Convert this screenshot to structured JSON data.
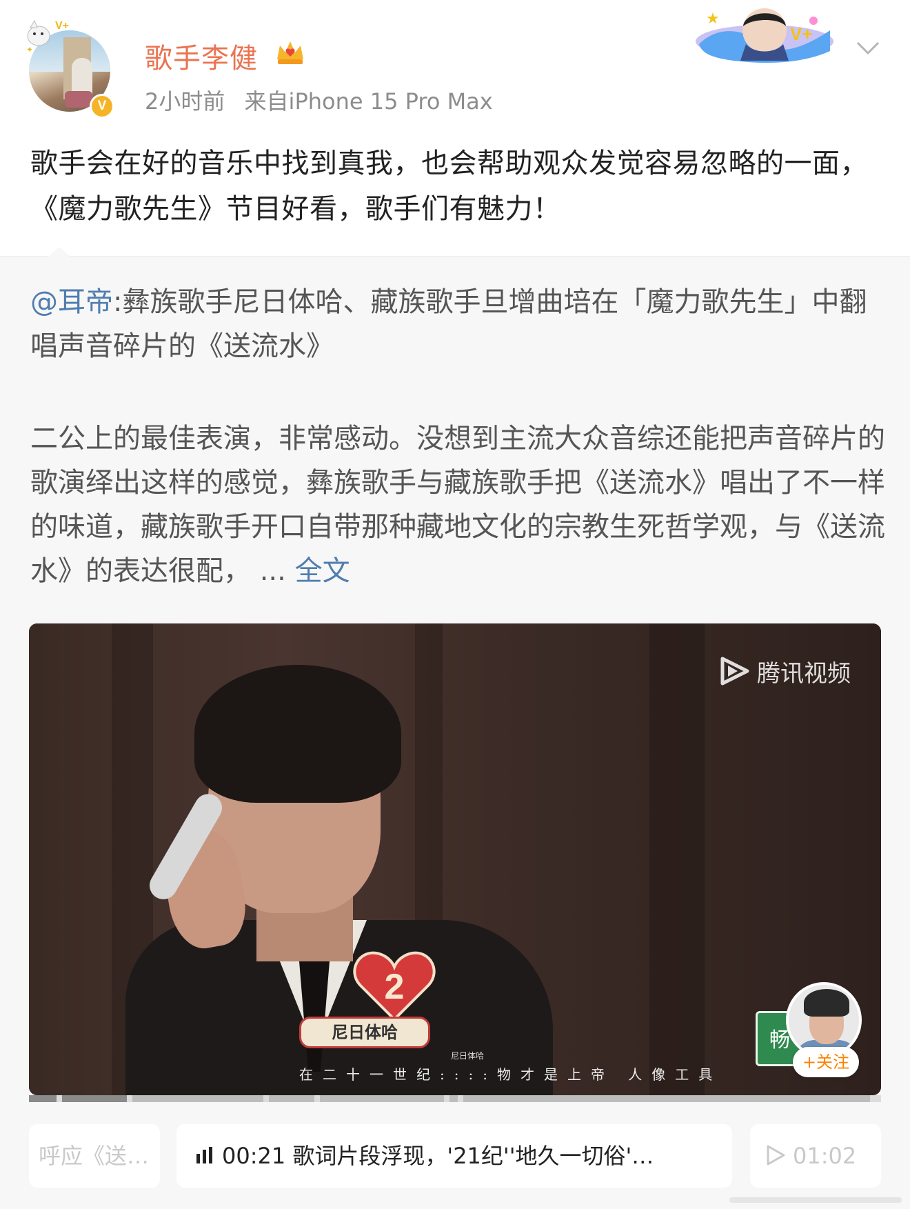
{
  "author": {
    "name": "歌手李健",
    "time": "2小时前",
    "source": "来自iPhone 15 Pro Max",
    "verified_mark": "V"
  },
  "post": {
    "text": "歌手会在好的音乐中找到真我，也会帮助观众发觉容易忽略的一面，《魔力歌先生》节目好看，歌手们有魅力！"
  },
  "repost": {
    "mention": "@耳帝",
    "header_text": ":彝族歌手尼日体哈、藏族歌手旦增曲培在「魔力歌先生」中翻唱声音碎片的《送流水》",
    "body_text": "二公上的最佳表演，非常感动。没想到主流大众音综还能把声音碎片的歌演绎出这样的感觉，彝族歌手与藏族歌手把《送流水》唱出了不一样的味道，藏族歌手开口自带那种藏地文化的宗教生死哲学观，与《送流水》的表达很配，",
    "ellipsis": " ... ",
    "read_more": "全文"
  },
  "video": {
    "watermark": "腾讯视频",
    "name_tag": "尼日体哈",
    "caption_small": "尼日体哈",
    "lyrics": "在二十一世纪::::物才是上帝 人像工具",
    "badge_number": "2",
    "side_icon_text": "畅",
    "follow_label": "+关注",
    "progress_played_fraction": 0.11
  },
  "chapters": {
    "left": "呼应《送…",
    "center_time": "00:21",
    "center_text": "歌词片段浮现，'21纪''地久一切俗'…",
    "right_time": "01:02"
  },
  "colors": {
    "username": "#eb7350",
    "link": "#507daf",
    "meta": "#8c8c8c",
    "follow": "#ff8200",
    "repost_bg": "#f7f7f7"
  },
  "icons": [
    "crown-icon",
    "chevron-down-icon",
    "verified-icon",
    "tencent-video-icon",
    "bars-icon",
    "play-icon"
  ]
}
